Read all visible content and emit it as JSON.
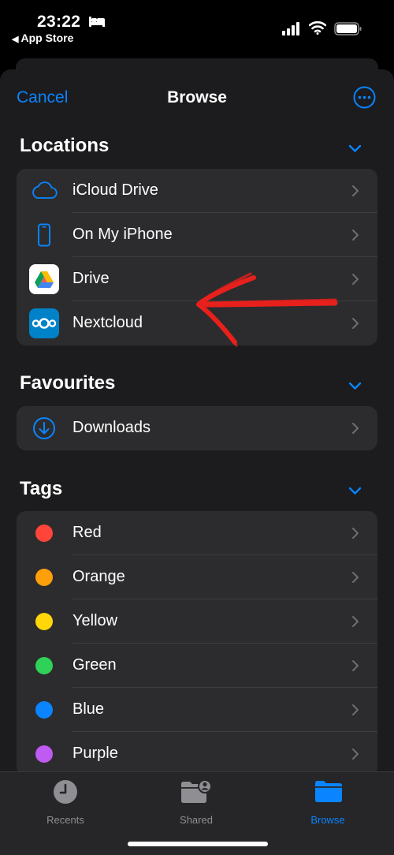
{
  "status_bar": {
    "time": "23:22",
    "back_app": "App Store"
  },
  "nav": {
    "cancel": "Cancel",
    "title": "Browse"
  },
  "sections": {
    "locations": {
      "header": "Locations",
      "items": [
        {
          "label": "iCloud Drive",
          "icon": "icloud-icon"
        },
        {
          "label": "On My iPhone",
          "icon": "iphone-icon"
        },
        {
          "label": "Drive",
          "icon": "google-drive-icon"
        },
        {
          "label": "Nextcloud",
          "icon": "nextcloud-icon"
        }
      ]
    },
    "favourites": {
      "header": "Favourites",
      "items": [
        {
          "label": "Downloads",
          "icon": "download-icon"
        }
      ]
    },
    "tags": {
      "header": "Tags",
      "items": [
        {
          "label": "Red",
          "color": "#ff453a"
        },
        {
          "label": "Orange",
          "color": "#ff9f0a"
        },
        {
          "label": "Yellow",
          "color": "#ffd60a"
        },
        {
          "label": "Green",
          "color": "#30d158"
        },
        {
          "label": "Blue",
          "color": "#0a84ff"
        },
        {
          "label": "Purple",
          "color": "#bf5af2"
        }
      ]
    }
  },
  "tab_bar": {
    "tabs": [
      {
        "label": "Recents",
        "icon": "clock-icon",
        "active": false
      },
      {
        "label": "Shared",
        "icon": "shared-folder-icon",
        "active": false
      },
      {
        "label": "Browse",
        "icon": "folder-icon",
        "active": true
      }
    ]
  },
  "colors": {
    "accent": "#0a84ff",
    "background": "#1c1c1e",
    "group": "#2c2c2e",
    "annotation": "#e8201c"
  }
}
